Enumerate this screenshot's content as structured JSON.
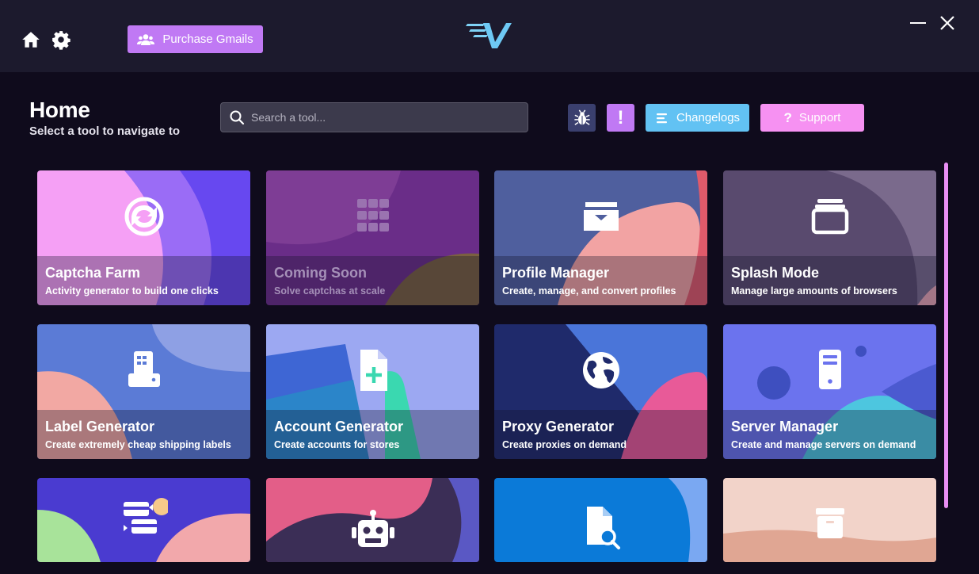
{
  "topbar": {
    "purchase_label": "Purchase Gmails",
    "icons": {
      "home": "home-icon",
      "settings": "gear-icon",
      "minimize": "minimize-icon",
      "close": "close-icon",
      "logo": "v-logo"
    }
  },
  "header": {
    "title": "Home",
    "subtitle": "Select a tool to navigate to",
    "search_placeholder": "Search a tool...",
    "changelogs_label": "Changelogs",
    "support_label": "Support",
    "support_icon": "?",
    "alert_icon": "!"
  },
  "colors": {
    "purchase": "#c079f4",
    "bug": "#3a3f6e",
    "alert": "#c079f4",
    "changelogs": "#62c2f3",
    "support": "#f691f2",
    "scrollbar": "#e88ef3"
  },
  "tools": [
    {
      "title": "Captcha Farm",
      "subtitle": "Activity generator to build one clicks",
      "icon": "captcha-icon"
    },
    {
      "title": "Coming Soon",
      "subtitle": "Solve captchas at scale",
      "icon": "grid-icon"
    },
    {
      "title": "Profile Manager",
      "subtitle": "Create, manage, and convert profiles",
      "icon": "inbox-icon"
    },
    {
      "title": "Splash Mode",
      "subtitle": "Manage large amounts of browsers",
      "icon": "windows-icon"
    },
    {
      "title": "Label Generator",
      "subtitle": "Create extremely cheap shipping labels",
      "icon": "printer-icon"
    },
    {
      "title": "Account Generator",
      "subtitle": "Create accounts for stores",
      "icon": "file-plus-icon"
    },
    {
      "title": "Proxy Generator",
      "subtitle": "Create proxies on demand",
      "icon": "globe-icon"
    },
    {
      "title": "Server Manager",
      "subtitle": "Create and manage servers on demand",
      "icon": "server-icon"
    },
    {
      "title": "",
      "subtitle": "",
      "icon": "cards-icon"
    },
    {
      "title": "",
      "subtitle": "",
      "icon": "robot-icon"
    },
    {
      "title": "",
      "subtitle": "",
      "icon": "file-search-icon"
    },
    {
      "title": "",
      "subtitle": "",
      "icon": "archive-icon"
    }
  ]
}
